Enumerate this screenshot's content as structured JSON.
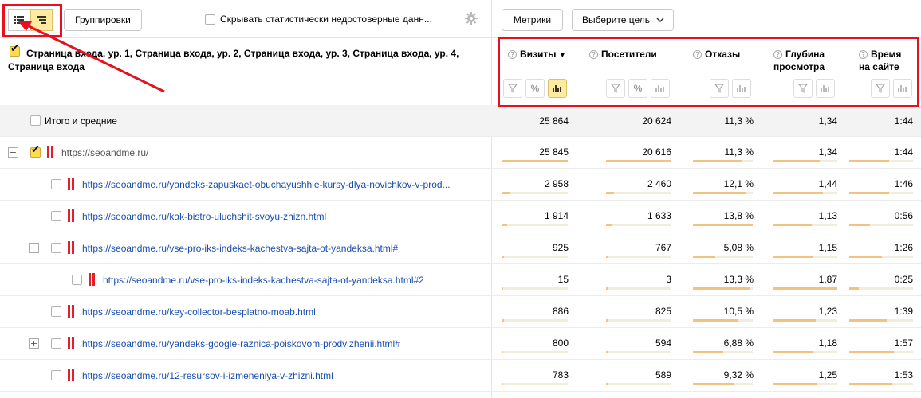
{
  "toolbar": {
    "groupings_label": "Группировки",
    "hide_stats_label": "Скрывать статистически недостоверные данн...",
    "metrics_label": "Метрики",
    "goal_label": "Выберите цель"
  },
  "dimension_header": "Страница входа, ур. 1, Страница входа, ур. 2, Страница входа, ур. 3, Страница входа, ур. 4, Страница входа",
  "columns": [
    {
      "label": "Визиты",
      "sort": "▼"
    },
    {
      "label": "Посетители"
    },
    {
      "label": "Отказы"
    },
    {
      "label": "Глубина просмотра"
    },
    {
      "label": "Время на сайте"
    }
  ],
  "totals": {
    "label": "Итого и средние",
    "values": [
      "25 864",
      "20 624",
      "11,3 %",
      "1,34",
      "1:44"
    ]
  },
  "rows": [
    {
      "url": "https://seoandme.ru/",
      "values": [
        "25 845",
        "20 616",
        "11,3 %",
        "1,34",
        "1:44"
      ],
      "bars": [
        1.0,
        1.0,
        0.82,
        0.72,
        0.62
      ]
    },
    {
      "url": "https://seoandme.ru/yandeks-zapuskaet-obuchayushhie-kursy-dlya-novichkov-v-prod...",
      "values": [
        "2 958",
        "2 460",
        "12,1 %",
        "1,44",
        "1:46"
      ],
      "bars": [
        0.12,
        0.12,
        0.88,
        0.77,
        0.63
      ]
    },
    {
      "url": "https://seoandme.ru/kak-bistro-uluchshit-svoyu-zhizn.html",
      "values": [
        "1 914",
        "1 633",
        "13,8 %",
        "1,13",
        "0:56"
      ],
      "bars": [
        0.08,
        0.08,
        1.0,
        0.6,
        0.33
      ]
    },
    {
      "url": "https://seoandme.ru/vse-pro-iks-indeks-kachestva-sajta-ot-yandeksa.html#",
      "values": [
        "925",
        "767",
        "5,08 %",
        "1,15",
        "1:26"
      ],
      "bars": [
        0.04,
        0.04,
        0.37,
        0.61,
        0.51
      ]
    },
    {
      "url": "https://seoandme.ru/vse-pro-iks-indeks-kachestva-sajta-ot-yandeksa.html#2",
      "values": [
        "15",
        "3",
        "13,3 %",
        "1,87",
        "0:25"
      ],
      "bars": [
        0.01,
        0.01,
        0.96,
        1.0,
        0.15
      ]
    },
    {
      "url": "https://seoandme.ru/key-collector-besplatno-moab.html",
      "values": [
        "886",
        "825",
        "10,5 %",
        "1,23",
        "1:39"
      ],
      "bars": [
        0.04,
        0.04,
        0.76,
        0.66,
        0.59
      ]
    },
    {
      "url": "https://seoandme.ru/yandeks-google-raznica-poiskovom-prodvizhenii.html#",
      "values": [
        "800",
        "594",
        "6,88 %",
        "1,18",
        "1:57"
      ],
      "bars": [
        0.03,
        0.03,
        0.5,
        0.63,
        0.7
      ]
    },
    {
      "url": "https://seoandme.ru/12-resursov-i-izmeneniya-v-zhizni.html",
      "values": [
        "783",
        "589",
        "9,32 %",
        "1,25",
        "1:53"
      ],
      "bars": [
        0.03,
        0.03,
        0.68,
        0.67,
        0.68
      ]
    }
  ],
  "colors": {
    "link": "#1a4eb0",
    "bar": "#f2c27e",
    "highlight": "#e8101e",
    "accent": "#ffdb4d"
  }
}
